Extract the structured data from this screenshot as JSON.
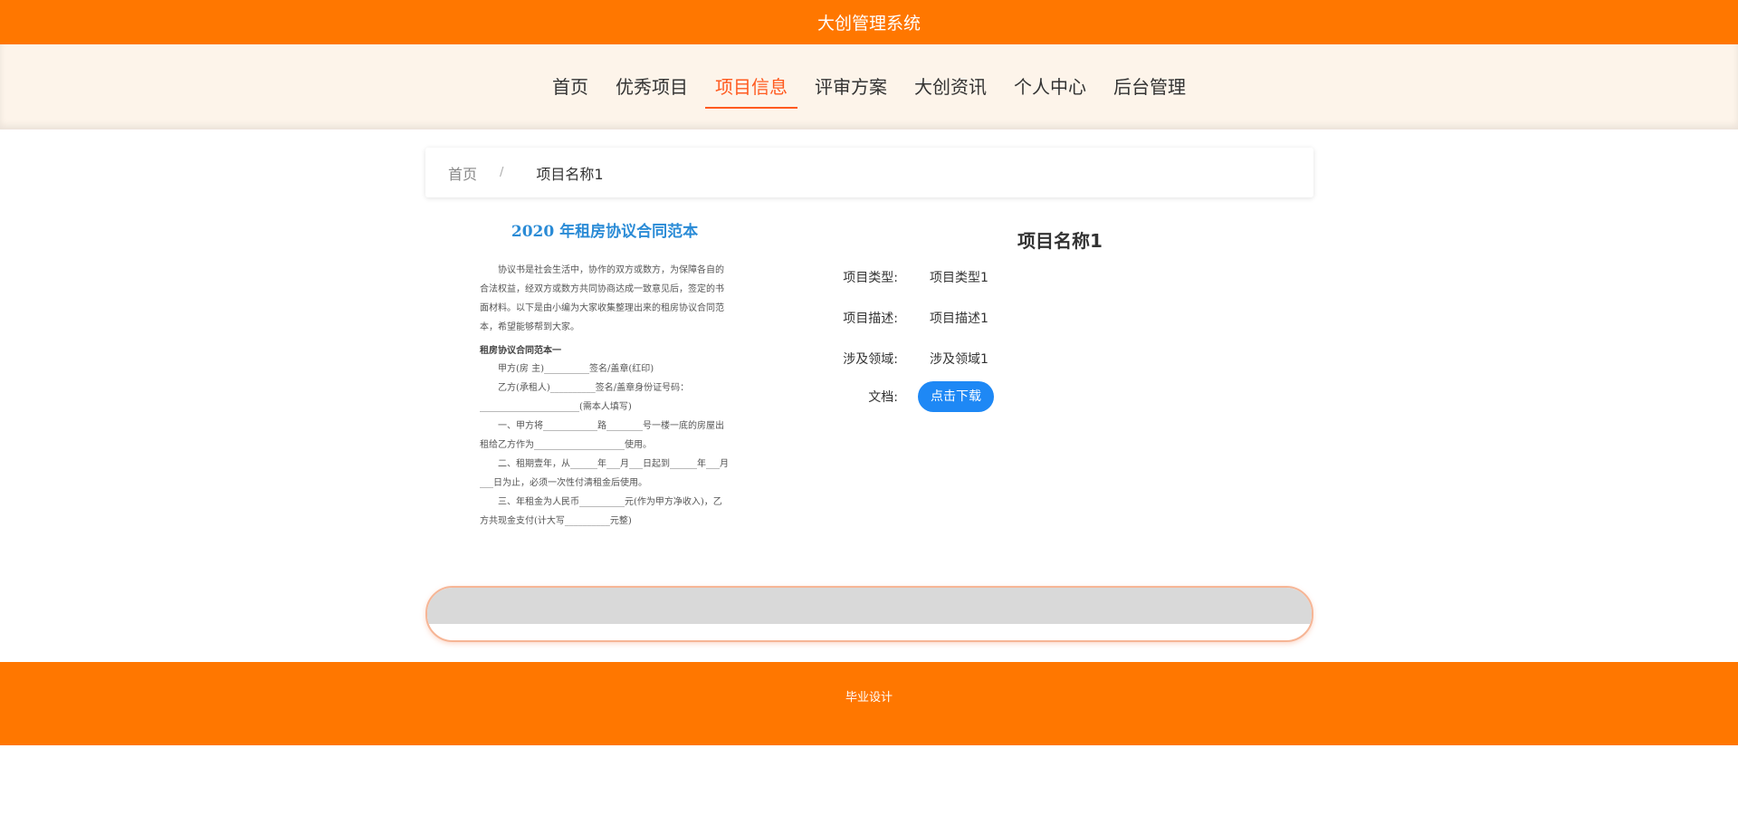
{
  "header": {
    "title": "大创管理系统"
  },
  "nav": {
    "items": [
      {
        "label": "首页"
      },
      {
        "label": "优秀项目"
      },
      {
        "label": "项目信息"
      },
      {
        "label": "评审方案"
      },
      {
        "label": "大创资讯"
      },
      {
        "label": "个人中心"
      },
      {
        "label": "后台管理"
      }
    ],
    "active": "项目信息"
  },
  "breadcrumb": {
    "home": "首页",
    "separator": "/",
    "current": "项目名称1"
  },
  "document_preview": {
    "title": "2020 年租房协议合同范本",
    "paragraphs": [
      "协议书是社会生活中，协作的双方或数方，为保障各自的合法权益，经双方或数方共同协商达成一致意见后，签定的书面材料。以下是由小编为大家收集整理出来的租房协议合同范本，希望能够帮到大家。",
      "租房协议合同范本一",
      "甲方(房 主)__________签名/盖章(红印)",
      "乙方(承租人)__________签名/盖章身份证号码：______________________(需本人填写)",
      "一、甲方将____________路________号一楼一底的房屋出租给乙方作为____________________使用。",
      "二、租期壹年，从______年___月___日起到______年___月___日为止，必须一次性付清租金后使用。",
      "三、年租金为人民币__________元(作为甲方净收入)，乙方共现金支付(计大写__________元整)"
    ]
  },
  "project": {
    "name": "项目名称1",
    "type_label": "项目类型:",
    "type_value": "项目类型1",
    "desc_label": "项目描述:",
    "desc_value": "项目描述1",
    "field_label": "涉及领域:",
    "field_value": "涉及领域1",
    "doc_label": "文档:",
    "download_label": "点击下载"
  },
  "footer": {
    "text": "毕业设计"
  },
  "colors": {
    "brand": "#ff7700",
    "nav_bg": "#fdf4ea",
    "active": "#ff5a1f",
    "button": "#1e88f5"
  }
}
